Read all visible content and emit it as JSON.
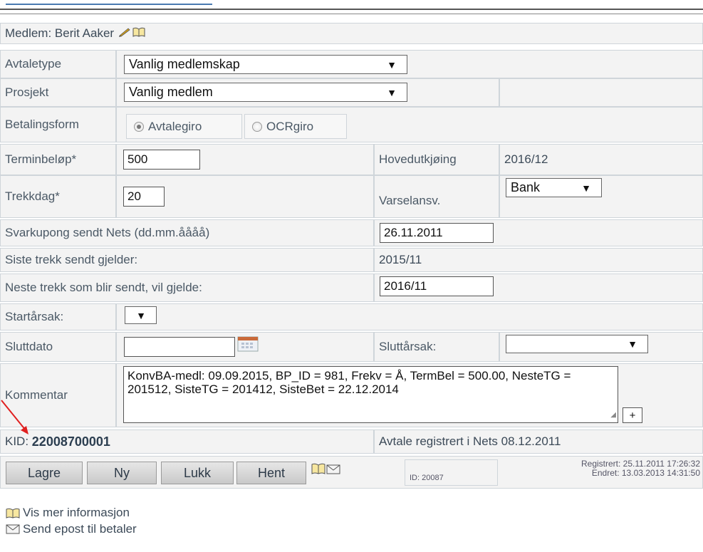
{
  "member": {
    "prefix": "Medlem:",
    "name": "Berit Aaker"
  },
  "labels": {
    "avtaletype": "Avtaletype",
    "prosjekt": "Prosjekt",
    "betalingsform": "Betalingsform",
    "terminbelop": "Terminbeløp*",
    "hovedutkjoring": "Hovedutkjøing",
    "trekkdag": "Trekkdag*",
    "varselansv": "Varselansv.",
    "svarkupong": "Svarkupong sendt Nets (dd.mm.åååå)",
    "siste_trekk": "Siste trekk sendt gjelder:",
    "neste_trekk": "Neste trekk som blir sendt, vil gjelde:",
    "startarsak": "Startårsak:",
    "sluttdato": "Sluttdato",
    "sluttarsak": "Sluttårsak:",
    "kommentar": "Kommentar"
  },
  "fields": {
    "avtaletype": "Vanlig medlemskap",
    "prosjekt": "Vanlig medlem",
    "betalingsform_options": [
      "Avtalegiro",
      "OCRgiro"
    ],
    "terminbelop": "500",
    "hovedutkjoring": "2016/12",
    "trekkdag": "20",
    "varselansv": "Bank",
    "svarkupong": "26.11.2011",
    "siste_trekk": "2015/11",
    "neste_trekk": "2016/11",
    "startarsak": "",
    "sluttdato": "",
    "sluttarsak": "",
    "kommentar": "KonvBA-medl: 09.09.2015, BP_ID = 981, Frekv = Å, TermBel = 500.00, NesteTG = 201512, SisteTG = 201412, SisteBet = 22.12.2014",
    "kommentar_plus": "+"
  },
  "kid": {
    "label": "KID:",
    "value": "22008700001"
  },
  "nets_status": "Avtale registrert i Nets 08.12.2011",
  "buttons": {
    "lagre": "Lagre",
    "ny": "Ny",
    "lukk": "Lukk",
    "hent": "Hent"
  },
  "record_id": "ID: 20087",
  "registrert": "Registrert: 25.11.2011 17:26:32",
  "endret": "Endret: 13.03.2013 14:31:50",
  "links": {
    "vis_mer": "Vis mer informasjon",
    "send_epost": "Send epost til betaler"
  },
  "colors": {
    "annotation_arrow": "#e02020",
    "kid_value": "#2c3e50"
  }
}
